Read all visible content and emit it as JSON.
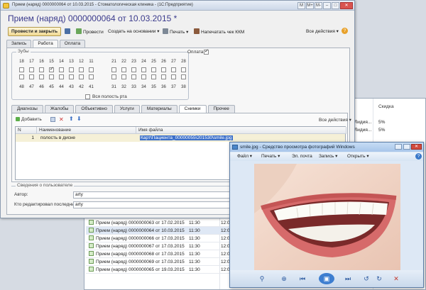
{
  "background_list": {
    "header_discount": "Скидка",
    "side_cells": [
      "Лидия...",
      "Лидия..."
    ],
    "side_values": [
      "5%",
      "5%"
    ],
    "rows": [
      {
        "doc": "Прием (наряд) 0000000063 от 17.02.2015",
        "time": "11:30",
        "extra": "12:0"
      },
      {
        "doc": "Прием (наряд) 0000000064 от 10.03.2015",
        "time": "11:30",
        "extra": "12:0"
      },
      {
        "doc": "Прием (наряд) 0000000066 от 17.03.2015",
        "time": "11:30",
        "extra": "12:0"
      },
      {
        "doc": "Прием (наряд) 0000000067 от 17.03.2015",
        "time": "11:30",
        "extra": "12:0"
      },
      {
        "doc": "Прием (наряд) 0000000068 от 17.03.2015",
        "time": "11:30",
        "extra": "12:0"
      },
      {
        "doc": "Прием (наряд) 0000000069 от 17.03.2015",
        "time": "11:30",
        "extra": "12:0"
      },
      {
        "doc": "Прием (наряд) 0000000065 от 19.03.2015",
        "time": "11:30",
        "extra": "12:0"
      }
    ]
  },
  "window": {
    "title": "Прием (наряд) 0000000064 от 10.03.2015 - Стоматологическая клиника - (1С:Предприятие)",
    "buttons": [
      "M",
      "M+",
      "M-",
      "–",
      "□",
      "✕"
    ]
  },
  "form": {
    "title": "Прием (наряд) 0000000064 от 10.03.2015 *",
    "toolbar": {
      "post_close": "Провести и закрыть",
      "post": "Провести",
      "create_based": "Создать на основании ▾",
      "print": "Печать ▾",
      "print_receipt": "Напечатать чек ККМ",
      "all_actions": "Все действия ▾",
      "help": "?"
    },
    "tabs": [
      "Запись",
      "Работа",
      "Оплата"
    ],
    "active_tab": "Работа",
    "teeth": {
      "legend": "Зубы",
      "upper_left": [
        "18",
        "17",
        "16",
        "15",
        "14",
        "13",
        "12",
        "11"
      ],
      "upper_right": [
        "21",
        "22",
        "23",
        "24",
        "25",
        "26",
        "27",
        "28"
      ],
      "lower_left": [
        "48",
        "47",
        "46",
        "45",
        "44",
        "43",
        "42",
        "41"
      ],
      "lower_right": [
        "31",
        "32",
        "33",
        "34",
        "35",
        "36",
        "37",
        "38"
      ],
      "all_mouth": "Вся полость рта"
    },
    "payment_label": "Оплата",
    "subtabs": [
      "Диагнозы",
      "Жалобы",
      "Объективно",
      "Услуги",
      "Материалы",
      "Снимки",
      "Прочее"
    ],
    "active_subtab": "Снимки",
    "grid_toolbar": {
      "add": "Добавить",
      "all_actions": "Все действия ▾"
    },
    "grid": {
      "headers": [
        "N",
        "Наименование",
        "Имя файла"
      ],
      "rows": [
        {
          "n": "1",
          "name": "полость в дисне",
          "file": "Карт\\Пациента_00000055\\201530\\smile.jpg"
        }
      ]
    },
    "user_info": {
      "legend": "Сведения о пользователе",
      "author_label": "Автор:",
      "author": "arty",
      "editor_label": "Кто редактировал последний:",
      "editor": "arty"
    }
  },
  "viewer": {
    "title": "smile.jpg - Средство просмотра фотографий Windows",
    "menu": [
      "Файл ▾",
      "Печать ▾",
      "Эл. почта",
      "Запись ▾",
      "Открыть ▾"
    ],
    "help": "?"
  }
}
